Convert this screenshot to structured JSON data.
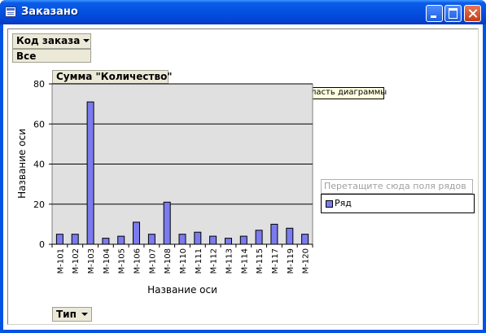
{
  "window": {
    "title": "Заказано"
  },
  "filter_field": {
    "label": "Код заказа",
    "value": "Все"
  },
  "data_field": {
    "label": "Сумма \"Количество\""
  },
  "category_field": {
    "label": "Тип"
  },
  "tooltip": "Область диаграммы",
  "series_drop_zone": "Перетащите сюда поля рядов",
  "colors": {
    "bar": "#7b7bef",
    "plot_background": "#e0e0e0",
    "titlebar": "#0450e0"
  },
  "chart_data": {
    "type": "bar",
    "categories": [
      "М-101",
      "М-102",
      "М-103",
      "М-104",
      "М-105",
      "М-106",
      "М-107",
      "М-108",
      "М-110",
      "М-111",
      "М-112",
      "М-113",
      "М-114",
      "М-115",
      "М-117",
      "М-119",
      "М-120"
    ],
    "series": [
      {
        "name": "Ряд",
        "values": [
          5,
          5,
          71,
          3,
          4,
          11,
          5,
          21,
          5,
          6,
          4,
          3,
          4,
          7,
          10,
          8,
          5
        ]
      }
    ],
    "ylim": [
      0,
      80
    ],
    "yticks": [
      0,
      20,
      40,
      60,
      80
    ],
    "xlabel": "Название оси",
    "ylabel": "Название оси",
    "grid": true,
    "legend": "right"
  }
}
